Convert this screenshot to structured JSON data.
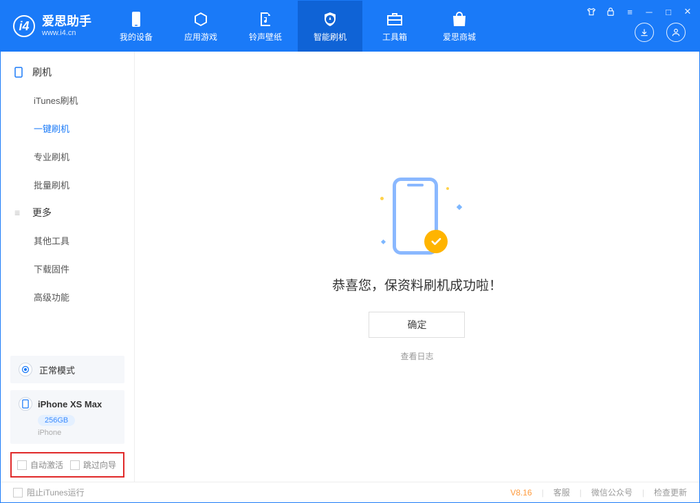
{
  "app": {
    "name": "爱思助手",
    "site": "www.i4.cn"
  },
  "nav": {
    "device": "我的设备",
    "apps": "应用游戏",
    "ringtone": "铃声壁纸",
    "flash": "智能刷机",
    "toolbox": "工具箱",
    "store": "爱思商城"
  },
  "sidebar": {
    "group_flash": "刷机",
    "items_flash": {
      "itunes": "iTunes刷机",
      "onekey": "一键刷机",
      "pro": "专业刷机",
      "batch": "批量刷机"
    },
    "group_more": "更多",
    "items_more": {
      "other": "其他工具",
      "download": "下载固件",
      "advanced": "高级功能"
    },
    "mode_card": "正常模式",
    "device_name": "iPhone XS Max",
    "device_storage": "256GB",
    "device_type": "iPhone",
    "auto_activate": "自动激活",
    "skip_guide": "跳过向导"
  },
  "main": {
    "message": "恭喜您，保资料刷机成功啦！",
    "ok": "确定",
    "view_log": "查看日志"
  },
  "statusbar": {
    "block_itunes": "阻止iTunes运行",
    "version": "V8.16",
    "cs": "客服",
    "wechat": "微信公众号",
    "update": "检查更新"
  }
}
